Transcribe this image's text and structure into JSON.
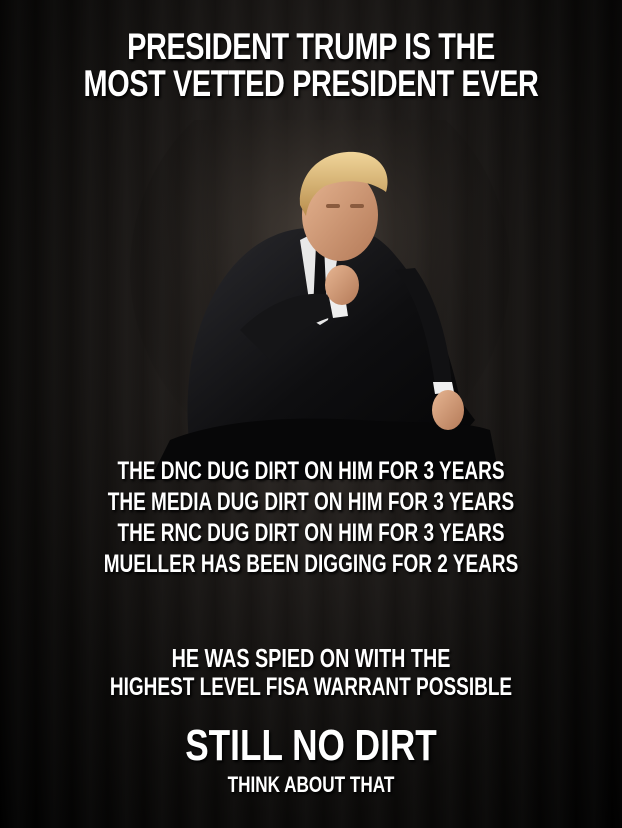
{
  "headline": {
    "line1": "PRESIDENT TRUMP IS THE",
    "line2": "MOST VETTED PRESIDENT EVER"
  },
  "claims": [
    "THE DNC DUG DIRT ON HIM FOR 3 YEARS",
    "THE MEDIA DUG DIRT ON HIM FOR 3 YEARS",
    "THE RNC DUG DIRT ON HIM FOR 3 YEARS",
    "MUELLER HAS BEEN DIGGING FOR 2 YEARS"
  ],
  "spied": {
    "line1": "HE WAS SPIED ON WITH THE",
    "line2": "HIGHEST LEVEL FISA WARRANT POSSIBLE"
  },
  "conclusion": "STILL NO DIRT",
  "tagline": "THINK ABOUT THAT",
  "colors": {
    "text": "#ffffff",
    "background": "#000000",
    "suit": "#121214",
    "skin": "#d9a27e",
    "hair": "#d8b877"
  }
}
